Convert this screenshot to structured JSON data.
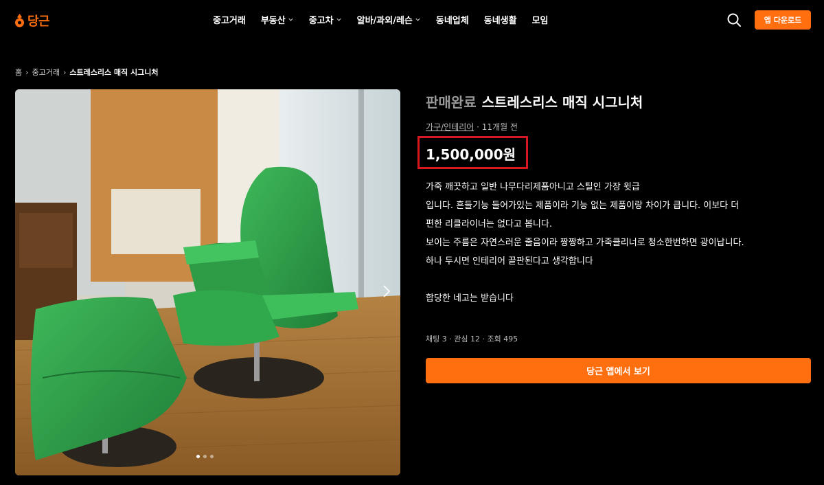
{
  "header": {
    "logo_text": "당근",
    "nav": [
      {
        "label": "중고거래",
        "dropdown": false
      },
      {
        "label": "부동산",
        "dropdown": true
      },
      {
        "label": "중고차",
        "dropdown": true
      },
      {
        "label": "알바/과외/레슨",
        "dropdown": true
      },
      {
        "label": "동네업체",
        "dropdown": false
      },
      {
        "label": "동네생활",
        "dropdown": false
      },
      {
        "label": "모임",
        "dropdown": false
      }
    ],
    "download_label": "앱 다운로드",
    "brand_color": "#ff6f0f"
  },
  "breadcrumb": {
    "home": "홈",
    "category": "중고거래",
    "current": "스트레스리스 매직 시그니처"
  },
  "product": {
    "status": "판매완료",
    "title": "스트레스리스 매직 시그니처",
    "category": "가구/인테리어",
    "time": "· 11개월 전",
    "price": "1,500,000원",
    "description": [
      "가죽 깨끗하고 일반 나무다리제품아니고 스틸인 가장 윗급",
      "입니다. 흔들기능 들어가있는 제품이라 기능 없는 제품이랑 차이가 큽니다. 이보다 더",
      "편한 리클라이너는 없다고 봅니다.",
      "보이는 주름은 자연스러운 줄음이라 짱짱하고 가죽클리너로 청소한번하면 광이납니다.",
      "하나 두시면 인테리어 끝판된다고 생각합니다",
      "",
      "합당한 네고는 받습니다"
    ],
    "stats": "채팅 3 · 관심 12 · 조회 495",
    "cta_label": "당근 앱에서 보기",
    "image_count": 3,
    "image_index": 1,
    "highlight_color": "#d7191f"
  }
}
